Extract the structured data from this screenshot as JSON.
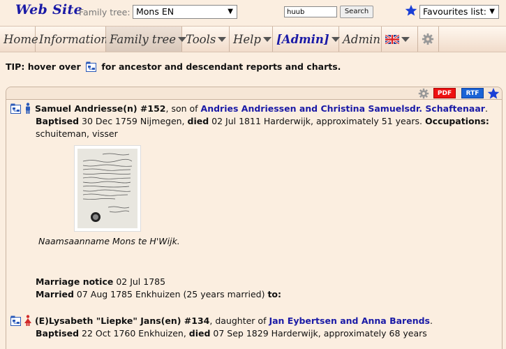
{
  "header": {
    "site_title": "Web Site",
    "family_tree_label": "Family tree:",
    "family_tree_value": "Mons EN",
    "search_value": "huub",
    "search_button": "Search",
    "favourites_value": "Favourites list:"
  },
  "menu": {
    "items": [
      {
        "label": "Home"
      },
      {
        "label": "Information"
      },
      {
        "label": "Family tree"
      },
      {
        "label": "Tools"
      },
      {
        "label": "Help"
      },
      {
        "label": "[Admin]"
      },
      {
        "label": "Admin"
      }
    ]
  },
  "tip": {
    "prefix": "TIP: hover over",
    "suffix": "for ancestor and descendant reports and charts."
  },
  "panel": {
    "pdf_label": "PDF",
    "rtf_label": "RTF"
  },
  "person1": {
    "name": "Samuel Andriesse(n) #152",
    "relation": ", son of ",
    "parents_link": "Andries Andriessen and Christina Samuelsdr. Schaftenaar",
    "baptised_label": "Baptised",
    "baptised_text": " 30 Dec 1759 Nijmegen, ",
    "died_label": "died",
    "died_text": " 02 Jul 1811 Harderwijk, approximately 51 years. ",
    "occupations_label": "Occupations:",
    "occupations_text": "schuiteman, visser",
    "photo_caption": "Naamsaanname Mons te H'Wijk."
  },
  "marriage": {
    "notice_label": "Marriage notice",
    "notice_text": " 02 Jul 1785",
    "married_label": "Married",
    "married_text": " 07 Aug 1785 Enkhuizen (25 years married) ",
    "to_label": "to:"
  },
  "person2": {
    "name": "(E)Lysabeth \"Liepke\" Jans(en) #134",
    "relation": ", daughter of ",
    "parents_link": "Jan Eybertsen and Anna Barends",
    "baptised_label": "Baptised",
    "baptised_text": " 22 Oct 1760 Enkhuizen, ",
    "died_label": "died",
    "died_text": " 07 Sep 1829 Harderwijk, approximately 68 years"
  },
  "colors": {
    "background": "#fbeee0",
    "link": "#1a1aa6",
    "pdf": "#ee1111",
    "rtf": "#1a63d6"
  }
}
